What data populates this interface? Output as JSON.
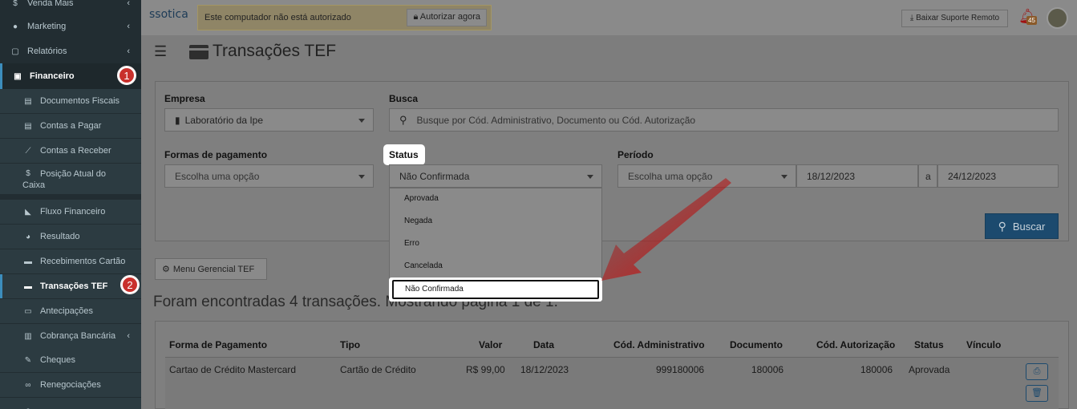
{
  "sidebar": {
    "venda_mais": "Venda Mais",
    "marketing": "Marketing",
    "relatorios": "Relatórios",
    "financeiro": "Financeiro",
    "items": [
      "Documentos Fiscais",
      "Contas a Pagar",
      "Contas a Receber",
      "Posição Atual do",
      "Caixa",
      "Fluxo Financeiro",
      "Resultado",
      "Recebimentos Cartão",
      "Transações TEF",
      "Antecipações",
      "Cobrança Bancária",
      "Cheques",
      "Renegociações"
    ],
    "step1": "1",
    "step2": "2"
  },
  "topbar": {
    "logo": "ssotica",
    "warning": "Este computador não está autorizado",
    "authorize": "Autorizar agora",
    "support": "Baixar Suporte Remoto",
    "bell_count": "45"
  },
  "page": {
    "title": "Transações TEF"
  },
  "filters": {
    "empresa_label": "Empresa",
    "empresa_value": "Laboratório da Ipe",
    "busca_label": "Busca",
    "busca_placeholder": "Busque por Cód. Administrativo, Documento ou Cód. Autorização",
    "formas_label": "Formas de pagamento",
    "formas_placeholder": "Escolha uma opção",
    "status_label": "Status",
    "status_value": "Não Confirmada",
    "periodo_label": "Período",
    "periodo_placeholder": "Escolha uma opção",
    "date_from": "18/12/2023",
    "date_sep": "a",
    "date_to": "24/12/2023",
    "buscar": "Buscar"
  },
  "status_options": [
    "Aprovada",
    "Negada",
    "Erro",
    "Cancelada",
    "Não Confirmada"
  ],
  "menu_tef": "Menu Gerencial TEF",
  "found_text": "Foram encontradas 4 transações. Mostrando página 1 de 1.",
  "table": {
    "headers": [
      "Forma de Pagamento",
      "Tipo",
      "Valor",
      "Data",
      "Cód. Administrativo",
      "Documento",
      "Cód. Autorização",
      "Status",
      "Vínculo"
    ],
    "rows": [
      [
        "Cartao de Crédito Mastercard",
        "Cartão de Crédito",
        "R$ 99,00",
        "18/12/2023",
        "999180006",
        "180006",
        "180006",
        "Aprovada",
        ""
      ]
    ]
  }
}
